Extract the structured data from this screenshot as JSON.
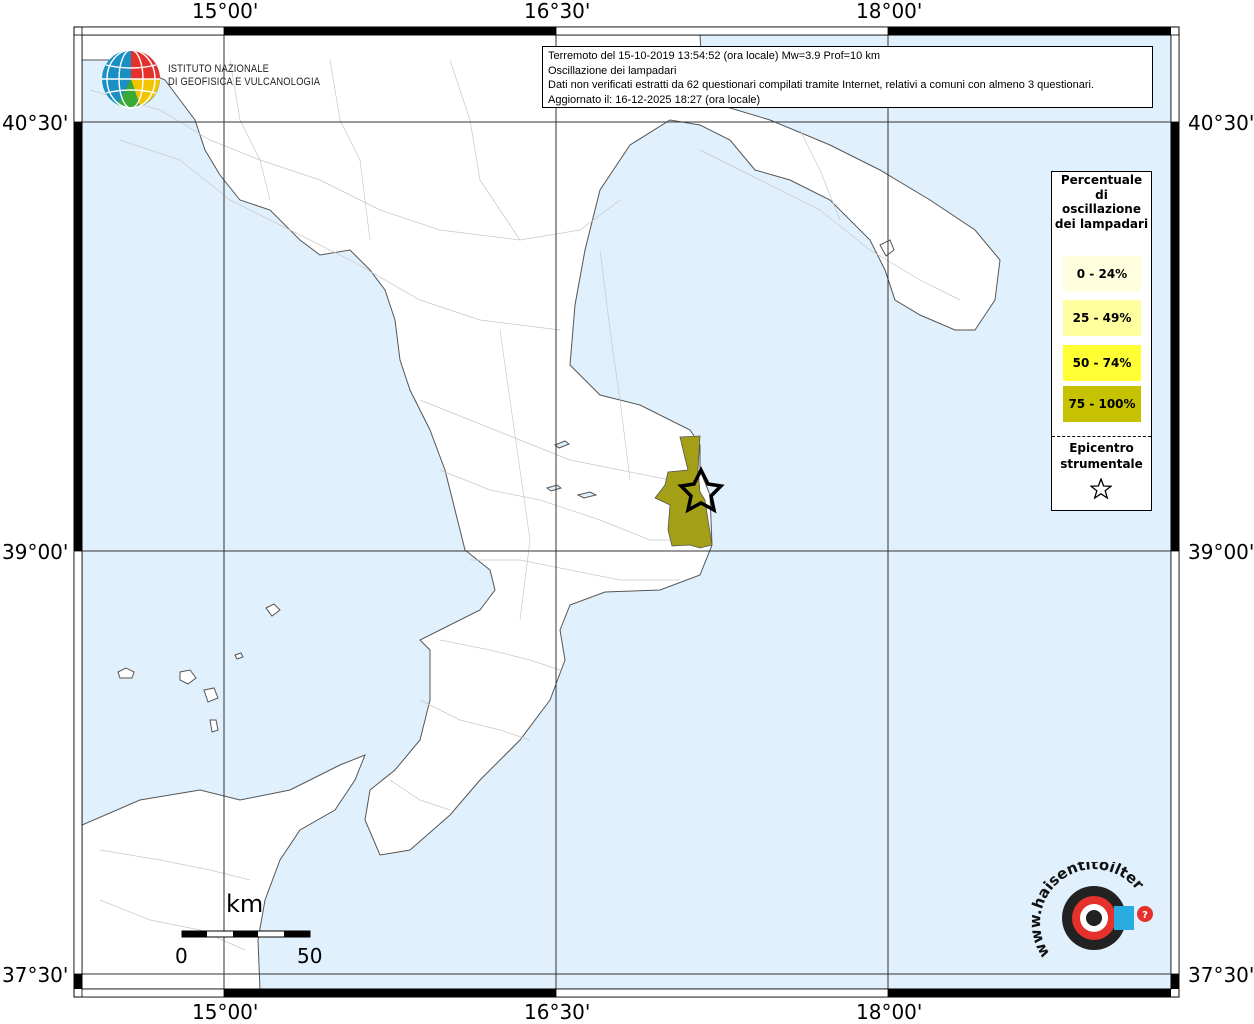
{
  "map": {
    "colors": {
      "sea": "#e0f0fc",
      "land": "#ffffff",
      "frame": "#000000",
      "cls_75_100": "#a3a017",
      "cls_50_74": "#ffff33",
      "cls_25_49": "#ffffa0",
      "cls_0_24": "#ffffe0"
    },
    "longitude_labels": [
      "15°00'",
      "16°30'",
      "18°00'"
    ],
    "latitude_labels": [
      "40°30'",
      "39°00'",
      "37°30'"
    ]
  },
  "info": {
    "line1": "Terremoto del 15-10-2019 13:54:52 (ora locale) Mw=3.9 Prof=10 km",
    "line2": "Oscillazione dei lampadari",
    "line3": "Dati non verificati estratti da 62 questionari compilati tramite Internet, relativi a comuni con almeno 3 questionari.",
    "line4": "Aggiornato il: 16-12-2025 18:27 (ora locale)"
  },
  "legend": {
    "title": "Percentuale di oscillazione dei lampadari",
    "classes": [
      {
        "label": "0 - 24%",
        "color": "#ffffe0"
      },
      {
        "label": "25 - 49%",
        "color": "#ffffa0"
      },
      {
        "label": "50 - 74%",
        "color": "#ffff33"
      },
      {
        "label": "75 - 100%",
        "color": "#c6c200"
      }
    ],
    "epicenter_label": "Epicentro strumentale",
    "epicenter_icon": "star-outline-icon"
  },
  "logos": {
    "ingv_line1": "ISTITUTO NAZIONALE",
    "ingv_line2": "DI GEOFISICA E VULCANOLOGIA",
    "hsit_text": "www.haisentitoilterremoto.it"
  },
  "scale_bar": {
    "unit": "km",
    "start": "0",
    "end": "50"
  }
}
